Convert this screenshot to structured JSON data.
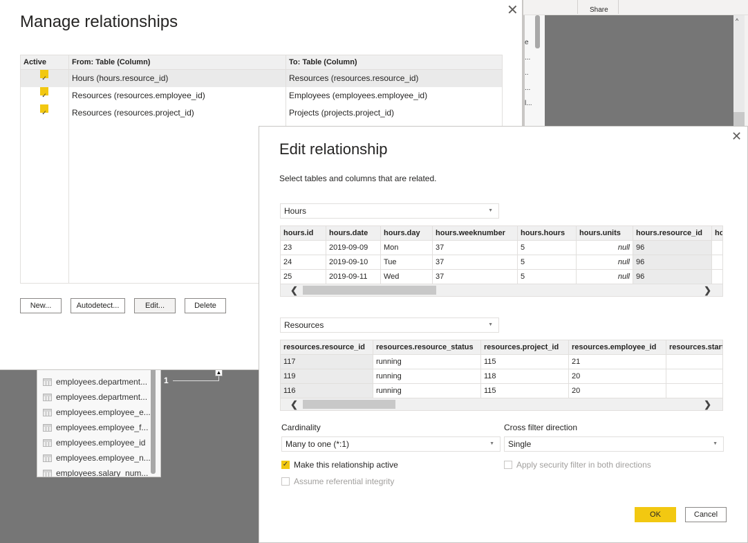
{
  "background": {
    "ribbon": {
      "share_label": "Share"
    },
    "fields_strip_fragments": [
      "e",
      "...",
      "..",
      "...",
      "l..."
    ],
    "field_list": [
      "employees.department...",
      "employees.department...",
      "employees.employee_e...",
      "employees.employee_f...",
      "employees.employee_id",
      "employees.employee_n...",
      "employees.salary_num..."
    ],
    "relationship_marker": "1"
  },
  "manage_dialog": {
    "title": "Manage relationships",
    "table": {
      "headers": {
        "active": "Active",
        "from": "From: Table (Column)",
        "to": "To: Table (Column)"
      },
      "rows": [
        {
          "active": true,
          "from": "Hours (hours.resource_id)",
          "to": "Resources (resources.resource_id)",
          "selected": true
        },
        {
          "active": true,
          "from": "Resources (resources.employee_id)",
          "to": "Employees (employees.employee_id)",
          "selected": false
        },
        {
          "active": true,
          "from": "Resources (resources.project_id)",
          "to": "Projects (projects.project_id)",
          "selected": false
        }
      ]
    },
    "buttons": {
      "new": "New...",
      "autodetect": "Autodetect...",
      "edit": "Edit...",
      "delete": "Delete"
    }
  },
  "edit_dialog": {
    "title": "Edit relationship",
    "subtitle": "Select tables and columns that are related.",
    "table1": {
      "selected": "Hours",
      "columns": [
        "hours.id",
        "hours.date",
        "hours.day",
        "hours.weeknumber",
        "hours.hours",
        "hours.units",
        "hours.resource_id",
        "ho"
      ],
      "rows": [
        [
          "23",
          "2019-09-09",
          "Mon",
          "37",
          "5",
          "null",
          "96",
          ""
        ],
        [
          "24",
          "2019-09-10",
          "Tue",
          "37",
          "5",
          "null",
          "96",
          ""
        ],
        [
          "25",
          "2019-09-11",
          "Wed",
          "37",
          "5",
          "null",
          "96",
          ""
        ]
      ],
      "highlighted_column": "hours.resource_id"
    },
    "table2": {
      "selected": "Resources",
      "columns": [
        "resources.resource_id",
        "resources.resource_status",
        "resources.project_id",
        "resources.employee_id",
        "resources.start_"
      ],
      "rows": [
        [
          "117",
          "running",
          "115",
          "21",
          ""
        ],
        [
          "119",
          "running",
          "118",
          "20",
          ""
        ],
        [
          "116",
          "running",
          "115",
          "20",
          ""
        ]
      ],
      "highlighted_column": "resources.resource_id"
    },
    "cardinality": {
      "label": "Cardinality",
      "value": "Many to one (*:1)"
    },
    "cross_filter": {
      "label": "Cross filter direction",
      "value": "Single"
    },
    "options": {
      "make_active": {
        "label": "Make this relationship active",
        "checked": true,
        "enabled": true
      },
      "referential_integrity": {
        "label": "Assume referential integrity",
        "checked": false,
        "enabled": false
      },
      "security_filter": {
        "label": "Apply security filter in both directions",
        "checked": false,
        "enabled": false
      }
    },
    "buttons": {
      "ok": "OK",
      "cancel": "Cancel"
    }
  },
  "colors": {
    "accent": "#f2c811",
    "canvas": "#767676"
  }
}
